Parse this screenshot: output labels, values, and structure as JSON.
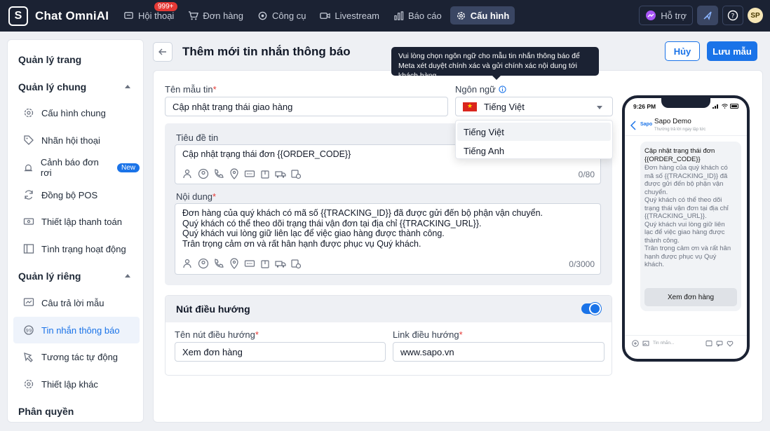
{
  "app": {
    "logo_letter": "S",
    "brand": "Chat OmniAI",
    "nav": [
      {
        "label": "Hội thoại",
        "badge": "999+"
      },
      {
        "label": "Đơn hàng"
      },
      {
        "label": "Công cụ"
      },
      {
        "label": "Livestream"
      },
      {
        "label": "Báo cáo"
      },
      {
        "label": "Cấu hình"
      }
    ],
    "support_label": "Hỗ trợ",
    "avatar_initials": "SP",
    "colors": {
      "topbar": "#1b2233",
      "accent": "#1a73e8"
    }
  },
  "sidebar": {
    "sections": {
      "page": "Quản lý trang",
      "general": "Quản lý chung",
      "private": "Quản lý riêng",
      "perm": "Phân quyền"
    },
    "general_items": [
      {
        "label": "Cấu hình chung",
        "icon": "gear-icon"
      },
      {
        "label": "Nhãn hội thoại",
        "icon": "tag-icon"
      },
      {
        "label": "Cảnh báo đơn rơi",
        "icon": "alarm-icon",
        "badge": "New"
      },
      {
        "label": "Đồng bộ POS",
        "icon": "sync-icon"
      },
      {
        "label": "Thiết lập thanh toán",
        "icon": "payment-icon"
      },
      {
        "label": "Tình trạng hoạt động",
        "icon": "layout-icon"
      }
    ],
    "private_items": [
      {
        "label": "Câu trả lời mẫu",
        "icon": "chart-message-icon"
      },
      {
        "label": "Tin nhắn thông báo",
        "icon": "quote-bubble-icon"
      },
      {
        "label": "Tương tác tự động",
        "icon": "auto-icon"
      },
      {
        "label": "Thiết lập khác",
        "icon": "gear-icon"
      }
    ]
  },
  "page": {
    "title": "Thêm mới tin nhắn thông báo",
    "cancel": "Hủy",
    "save": "Lưu mẫu",
    "tooltip": "Vui lòng chọn ngôn ngữ cho mẫu tin nhắn thông báo để Meta xét duyệt chính xác và gửi chính xác nội dung tới khách hàng."
  },
  "form": {
    "template_name_label": "Tên mẫu tin",
    "template_name_value": "Cập nhật trạng thái giao hàng",
    "language_label": "Ngôn ngữ",
    "language_value": "Tiếng Việt",
    "language_options": [
      "Tiếng Việt",
      "Tiếng Anh"
    ],
    "subject_label": "Tiêu đề tin",
    "subject_value": "Cập nhật trạng thái đơn {{ORDER_CODE}}",
    "subject_counter": "0/80",
    "content_label": "Nội dung",
    "content_lines": [
      "Đơn hàng của quý khách có mã số {{TRACKING_ID}} đã được gửi đến bộ phận vận chuyển.",
      "Quý khách có thể theo dõi trạng thái vận đơn tại địa chỉ {{TRACKING_URL}}.",
      "Quý khách vui lòng giữ liên lạc để việc giao hàng được thành công.",
      "Trân trọng cảm ơn và rất hân hạnh được phục vụ Quý khách."
    ],
    "content_counter": "0/3000",
    "nav_button_title": "Nút điều hướng",
    "nav_button_enabled": true,
    "button_name_label": "Tên nút điều hướng",
    "button_name_value": "Xem đơn hàng",
    "button_link_label": "Link điều hướng",
    "button_link_value": "www.sapo.vn"
  },
  "preview": {
    "time": "9:26 PM",
    "page_logo": "Sapo",
    "page_name": "Sapo Demo",
    "page_status": "Thường trả lời ngay lập tức",
    "title_lines": [
      "Cập nhật trạng thái đơn",
      "{{ORDER_CODE}}"
    ],
    "body_lines": [
      "Đơn hàng của quý khách có",
      "mã số {{TRACKING_ID}} đã",
      "được gửi đến bộ phận vận",
      "chuyển.",
      "Quý khách có thể theo dõi",
      "trạng thái vận đơn tại địa chỉ",
      "{{TRACKING_URL}}.",
      "Quý khách vui lòng giữ liên",
      "lạc để việc giao hàng được",
      "thành công.",
      "Trân trọng cảm ơn và rất hân",
      "hạnh được phục vụ Quý",
      "khách."
    ],
    "button": "Xem đơn hàng",
    "input_placeholder": "Tin nhắn..."
  }
}
